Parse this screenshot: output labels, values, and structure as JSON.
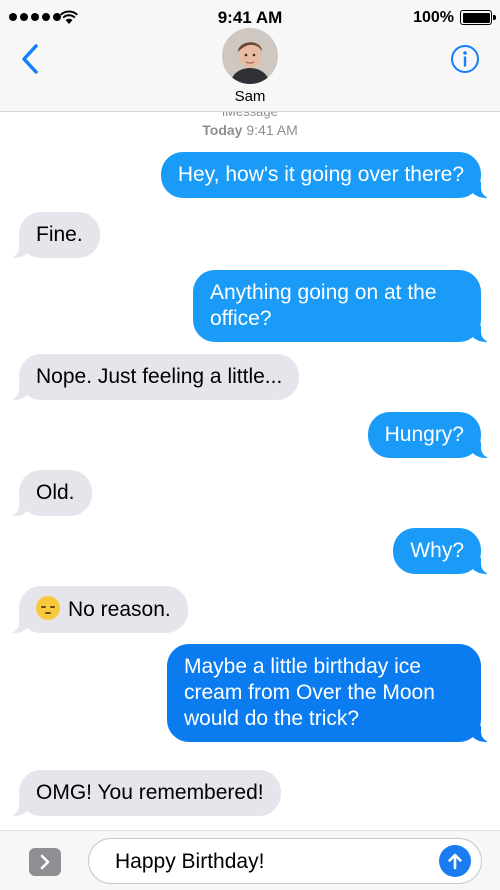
{
  "status_bar": {
    "time": "9:41 AM",
    "battery": "100%",
    "icons": [
      "signal-dots-icon",
      "wifi-icon",
      "battery-icon"
    ]
  },
  "header": {
    "contact_name": "Sam",
    "back_icon": "chevron-left-icon",
    "info_icon": "info-icon"
  },
  "transcript": {
    "service_label": "iMessage",
    "timestamp_day": "Today",
    "timestamp_time": "9:41 AM",
    "messages": [
      {
        "direction": "outgoing",
        "text": "Hey, how's it going over there?"
      },
      {
        "direction": "incoming",
        "text": "Fine."
      },
      {
        "direction": "outgoing",
        "text": "Anything going on at the office?"
      },
      {
        "direction": "incoming",
        "text": "Nope. Just feeling a little..."
      },
      {
        "direction": "outgoing",
        "text": "Hungry?"
      },
      {
        "direction": "incoming",
        "text": "Old."
      },
      {
        "direction": "outgoing",
        "text": "Why?"
      },
      {
        "direction": "incoming",
        "text": "No reason.",
        "emoji": "pensive-face-emoji"
      },
      {
        "direction": "outgoing",
        "text": "Maybe a little birthday ice cream from Over the Moon would do the trick?"
      },
      {
        "direction": "incoming",
        "text": "OMG! You remembered!"
      }
    ]
  },
  "composer": {
    "text": "Happy Birthday!",
    "apps_icon": "chevron-right-icon",
    "send_icon": "arrow-up-icon"
  },
  "colors": {
    "outgoing_bubble": "#1a9bf7",
    "incoming_bubble": "#e6e5eb",
    "accent": "#147efb"
  }
}
